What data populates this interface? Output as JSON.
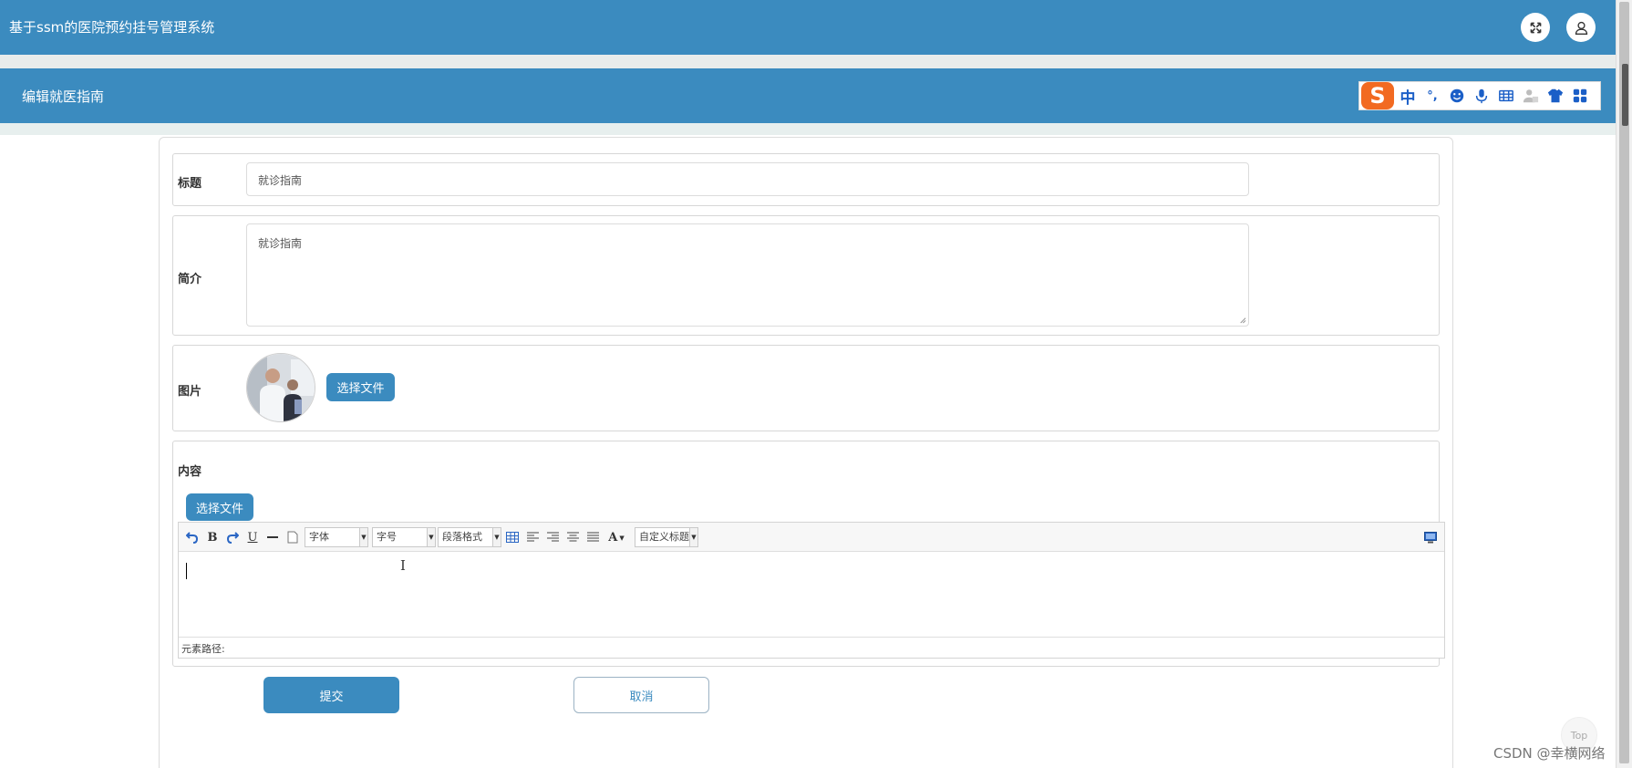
{
  "header": {
    "app_title": "基于ssm的医院预约挂号管理系统"
  },
  "sub_header": {
    "title": "编辑就医指南"
  },
  "ime_toolbar": {
    "logo": "S",
    "mode_label": "中",
    "punct_label": "°,",
    "icons": [
      "emoji-icon",
      "microphone-icon",
      "keyboard-icon",
      "user-icon",
      "skin-icon",
      "apps-icon"
    ]
  },
  "form": {
    "title": {
      "label": "标题",
      "value": "就诊指南"
    },
    "intro": {
      "label": "简介",
      "value": "就诊指南"
    },
    "image": {
      "label": "图片",
      "choose_label": "选择文件"
    },
    "content": {
      "label": "内容",
      "choose_label": "选择文件",
      "toolbar": {
        "font_family_placeholder": "字体",
        "font_size_placeholder": "字号",
        "paragraph_placeholder": "段落格式",
        "custom_title_placeholder": "自定义标题",
        "bold": "B",
        "underline": "U",
        "font_color": "A"
      },
      "element_path_label": "元素路径:"
    }
  },
  "actions": {
    "submit_label": "提交",
    "cancel_label": "取消"
  },
  "watermark": "CSDN @幸横网络",
  "back_to_top": "Top",
  "colors": {
    "primary": "#3b8bbf",
    "ime_orange": "#f26a21",
    "ime_blue": "#1b5fc7"
  }
}
